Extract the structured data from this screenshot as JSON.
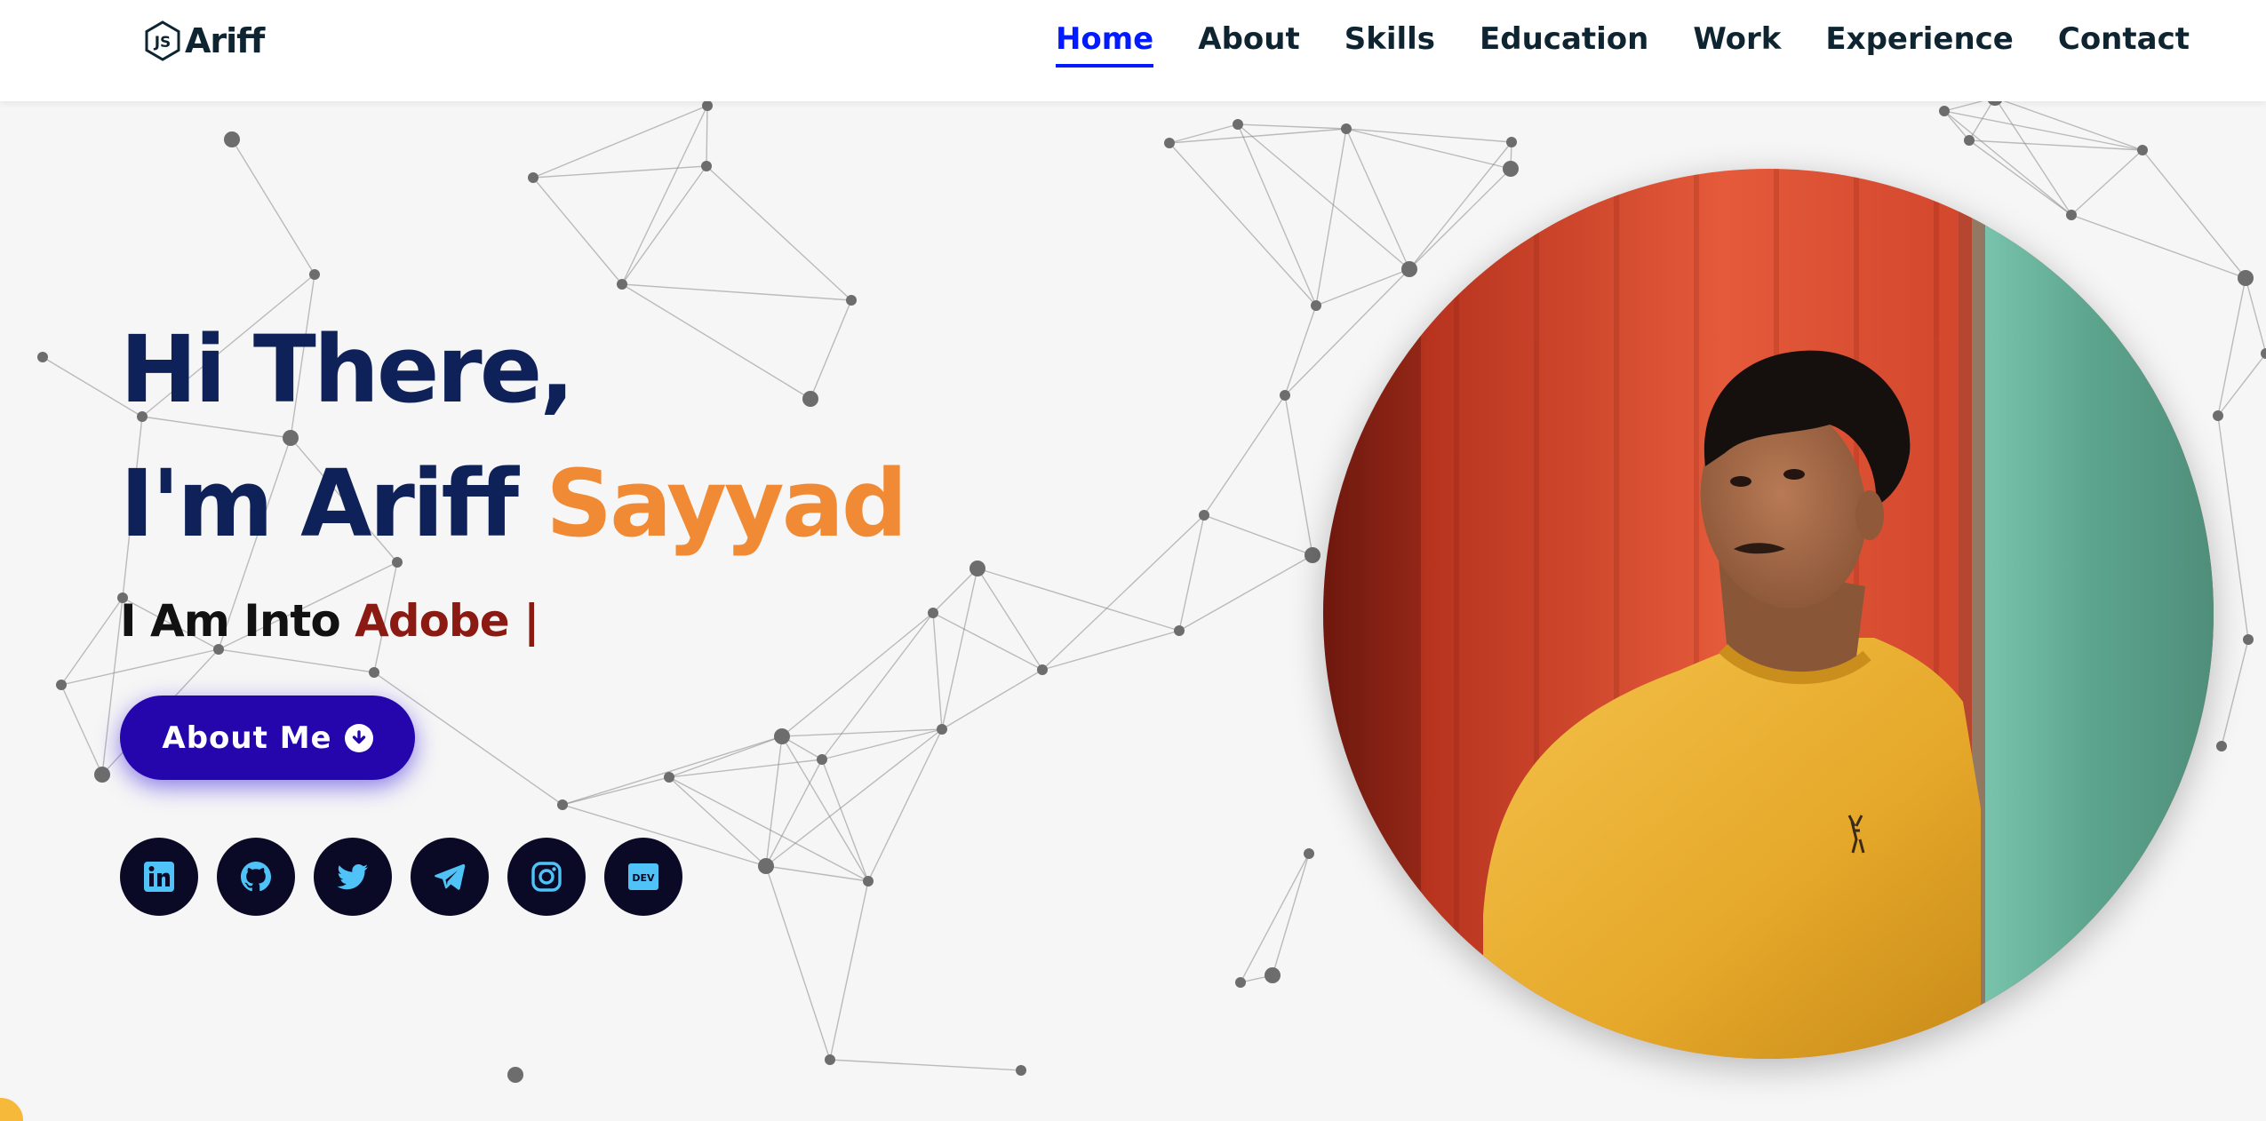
{
  "brand": {
    "name": "Ariff",
    "icon": "js-hexagon-icon"
  },
  "nav": {
    "items": [
      {
        "label": "Home",
        "active": true
      },
      {
        "label": "About",
        "active": false
      },
      {
        "label": "Skills",
        "active": false
      },
      {
        "label": "Education",
        "active": false
      },
      {
        "label": "Work",
        "active": false
      },
      {
        "label": "Experience",
        "active": false
      },
      {
        "label": "Contact",
        "active": false
      }
    ]
  },
  "hero": {
    "greeting": "Hi There,",
    "intro": "I'm Ariff",
    "surname": "Sayyad",
    "typed_prefix": "I Am Into",
    "typed_word": "Adobe",
    "cursor": "|",
    "about_button": "About Me",
    "socials": [
      {
        "name": "linkedin-icon"
      },
      {
        "name": "github-icon"
      },
      {
        "name": "twitter-icon"
      },
      {
        "name": "telegram-icon"
      },
      {
        "name": "instagram-icon"
      },
      {
        "name": "dev-icon"
      }
    ]
  },
  "colors": {
    "navy": "#0e2158",
    "orange": "#f08a34",
    "active_nav": "#011aff",
    "button": "#2506ad",
    "typed_word": "#8b1a12",
    "social_bg": "#0a0a26",
    "social_icon": "#4fc3f7"
  }
}
